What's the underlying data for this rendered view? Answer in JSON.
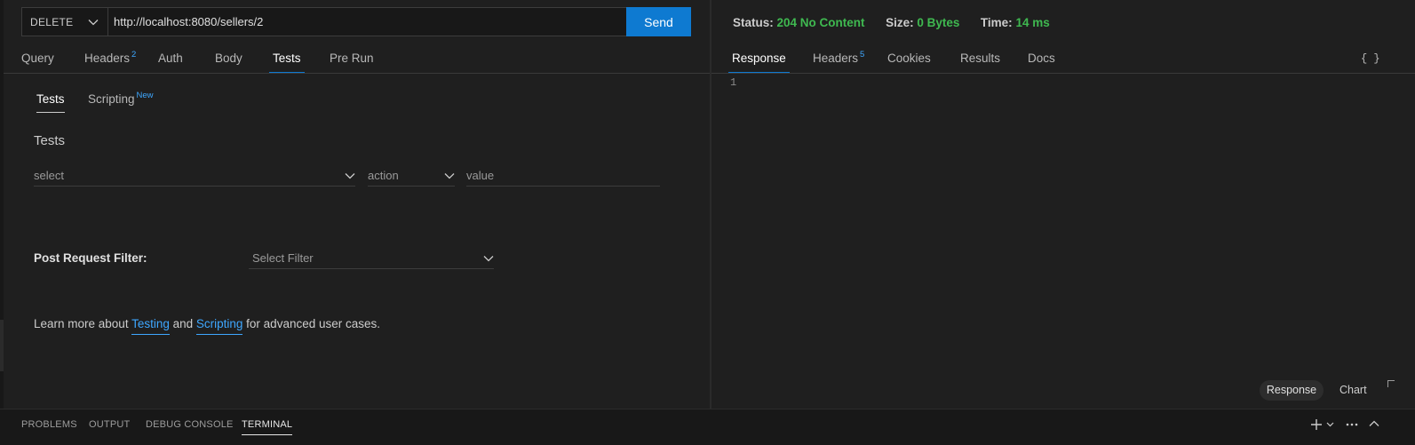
{
  "request": {
    "method": "DELETE",
    "url": "http://localhost:8080/sellers/2",
    "send_label": "Send",
    "tabs": [
      {
        "label": "Query",
        "badge": ""
      },
      {
        "label": "Headers",
        "badge": "2"
      },
      {
        "label": "Auth",
        "badge": ""
      },
      {
        "label": "Body",
        "badge": ""
      },
      {
        "label": "Tests",
        "badge": ""
      },
      {
        "label": "Pre Run",
        "badge": ""
      }
    ],
    "active_tab": "Tests",
    "subtabs": [
      {
        "label": "Tests",
        "badge": ""
      },
      {
        "label": "Scripting",
        "badge": "New"
      }
    ],
    "tests": {
      "title": "Tests",
      "select_placeholder": "select",
      "action_placeholder": "action",
      "value_placeholder": "value"
    },
    "filter": {
      "label": "Post Request Filter:",
      "placeholder": "Select Filter"
    },
    "learn": {
      "prefix": "Learn more about ",
      "link1": "Testing",
      "middle": " and ",
      "link2": "Scripting",
      "suffix": " for advanced user cases."
    }
  },
  "response": {
    "status_label": "Status:",
    "status_value": "204 No Content",
    "size_label": "Size:",
    "size_value": "0 Bytes",
    "time_label": "Time:",
    "time_value": "14 ms",
    "tabs": [
      {
        "label": "Response",
        "badge": ""
      },
      {
        "label": "Headers",
        "badge": "5"
      },
      {
        "label": "Cookies",
        "badge": ""
      },
      {
        "label": "Results",
        "badge": ""
      },
      {
        "label": "Docs",
        "badge": ""
      }
    ],
    "active_tab": "Response",
    "line_number": "1",
    "format_icon": "{ }",
    "view_toggle": {
      "response": "Response",
      "chart": "Chart"
    }
  },
  "bottom_panel": {
    "tabs": [
      "PROBLEMS",
      "OUTPUT",
      "DEBUG CONSOLE",
      "TERMINAL"
    ],
    "active_tab": "TERMINAL",
    "icons": [
      "plus-icon",
      "chevron-down-icon",
      "ellipsis-icon",
      "chevron-up-icon"
    ]
  },
  "colors": {
    "accent": "#0e7ad1",
    "link": "#3ea7ff",
    "success": "#3fb950",
    "background": "#1f1f1f"
  }
}
